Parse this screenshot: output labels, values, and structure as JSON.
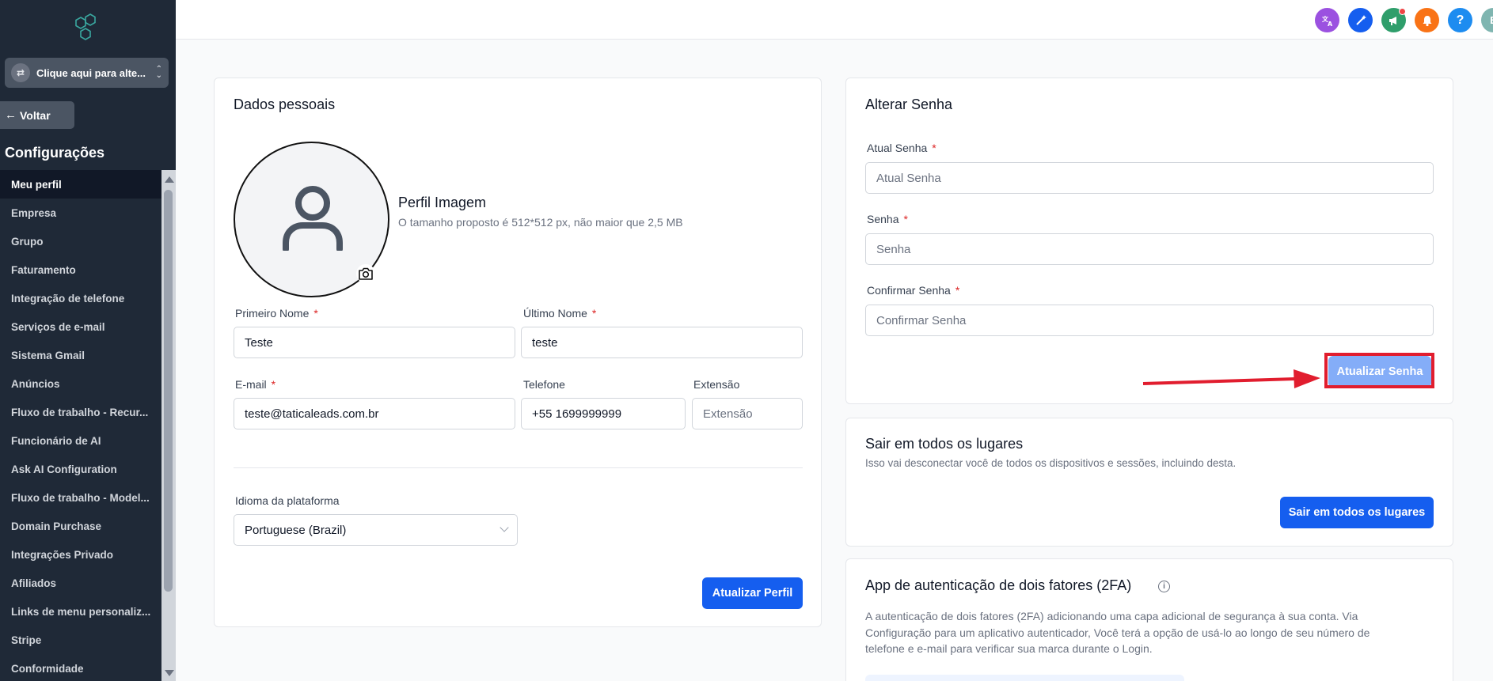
{
  "sidebar": {
    "switcher_label": "Clique aqui para alte...",
    "back_label": "Voltar",
    "section_title": "Configurações",
    "items": [
      {
        "label": "Meu perfil",
        "active": true
      },
      {
        "label": "Empresa"
      },
      {
        "label": "Grupo"
      },
      {
        "label": "Faturamento"
      },
      {
        "label": "Integração de telefone"
      },
      {
        "label": "Serviços de e-mail"
      },
      {
        "label": "Sistema Gmail"
      },
      {
        "label": "Anúncios"
      },
      {
        "label": "Fluxo de trabalho - Recur..."
      },
      {
        "label": "Funcionário de AI"
      },
      {
        "label": "Ask AI Configuration"
      },
      {
        "label": "Fluxo de trabalho - Model..."
      },
      {
        "label": "Domain Purchase"
      },
      {
        "label": "Integrações Privado"
      },
      {
        "label": "Afiliados"
      },
      {
        "label": "Links de menu personaliz..."
      },
      {
        "label": "Stripe"
      },
      {
        "label": "Conformidade"
      }
    ]
  },
  "topbar": {
    "icons": [
      {
        "name": "translate-icon",
        "color": "#9b51e0",
        "glyph": "文A"
      },
      {
        "name": "magic-icon",
        "color": "#155eef",
        "glyph": "✦"
      },
      {
        "name": "megaphone-icon",
        "color": "#2f9e6b",
        "glyph": "📢"
      },
      {
        "name": "bell-icon",
        "color": "#f97316",
        "glyph": "🔔"
      },
      {
        "name": "help-icon",
        "color": "#1d8cf0",
        "glyph": "?"
      }
    ],
    "avatar_initial": "E"
  },
  "profile": {
    "title": "Dados pessoais",
    "image_title": "Perfil Imagem",
    "image_hint": "O tamanho proposto é 512*512 px, não maior que 2,5 MB",
    "first_name_label": "Primeiro Nome",
    "first_name_value": "Teste",
    "last_name_label": "Último Nome",
    "last_name_value": "teste",
    "email_label": "E-mail",
    "email_value": "teste@taticaleads.com.br",
    "phone_label": "Telefone",
    "phone_value": "+55 1699999999",
    "extension_label": "Extensão",
    "extension_placeholder": "Extensão",
    "language_label": "Idioma da plataforma",
    "language_value": "Portuguese (Brazil)",
    "update_button": "Atualizar Perfil"
  },
  "password": {
    "title": "Alterar Senha",
    "current_label": "Atual Senha",
    "current_placeholder": "Atual Senha",
    "new_label": "Senha",
    "new_placeholder": "Senha",
    "confirm_label": "Confirmar Senha",
    "confirm_placeholder": "Confirmar Senha",
    "update_button": "Atualizar Senha"
  },
  "logout_all": {
    "title": "Sair em todos os lugares",
    "description": "Isso vai desconectar você de todos os dispositivos e sessões, incluindo desta.",
    "button": "Sair em todos os lugares"
  },
  "twofa": {
    "title": "App de autenticação de dois fatores (2FA)",
    "description_line1": "A autenticação de dois fatores (2FA) adicionando uma capa adicional de segurança à sua conta. Via",
    "description_line2": "Configuração para um aplicativo autenticador, Você terá a opção de usá-lo ao longo de seu número de",
    "description_line3": "telefone e e-mail para verificar sua marca durante o Login."
  },
  "colors": {
    "primary": "#155eef",
    "primary_disabled": "#84adf8",
    "sidebar_bg": "#1f2937",
    "annotation_red": "#e11d2e"
  }
}
